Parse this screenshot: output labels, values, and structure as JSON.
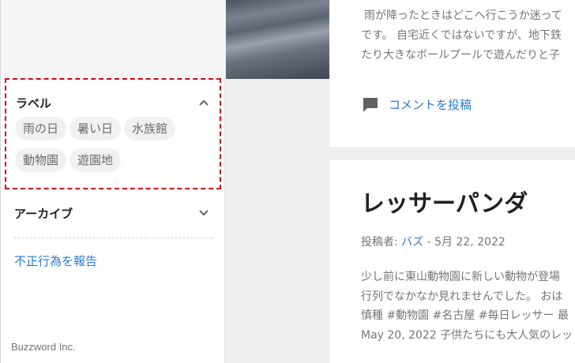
{
  "sidebar": {
    "labels_widget": {
      "title": "ラベル",
      "chips": [
        "雨の日",
        "暑い日",
        "水族館",
        "動物園",
        "遊園地"
      ]
    },
    "archive_title": "アーカイブ",
    "report_link": "不正行為を報告",
    "footer_brand": "Buzzword Inc."
  },
  "post1": {
    "snippet_lines": [
      "雨が降ったときはどこへ行こうか迷って",
      "です。 自宅近くではないですが、地下鉄",
      "たり大きなボールプールで遊んだりと子"
    ],
    "comment_label": "コメントを投稿"
  },
  "post2": {
    "title": "レッサーパンダ",
    "meta_prefix": "投稿者: ",
    "author": "バズ",
    "meta_sep": " - ",
    "date": "5月 22, 2022",
    "excerpt_lines": [
      "少し前に東山動物園に新しい動物が登場",
      "行列でなかなか見れませんでした。 おは",
      "慎種 #動物園 #名古屋 #毎日レッサー 最",
      "May 20, 2022 子供たちにも大人気のレッ"
    ]
  },
  "colors": {
    "accent": "#2a7bd4",
    "highlight_border": "#d0021b"
  },
  "icons": {
    "collapse": "chevron-up-icon",
    "expand": "chevron-down-icon",
    "comment": "comment-icon"
  }
}
